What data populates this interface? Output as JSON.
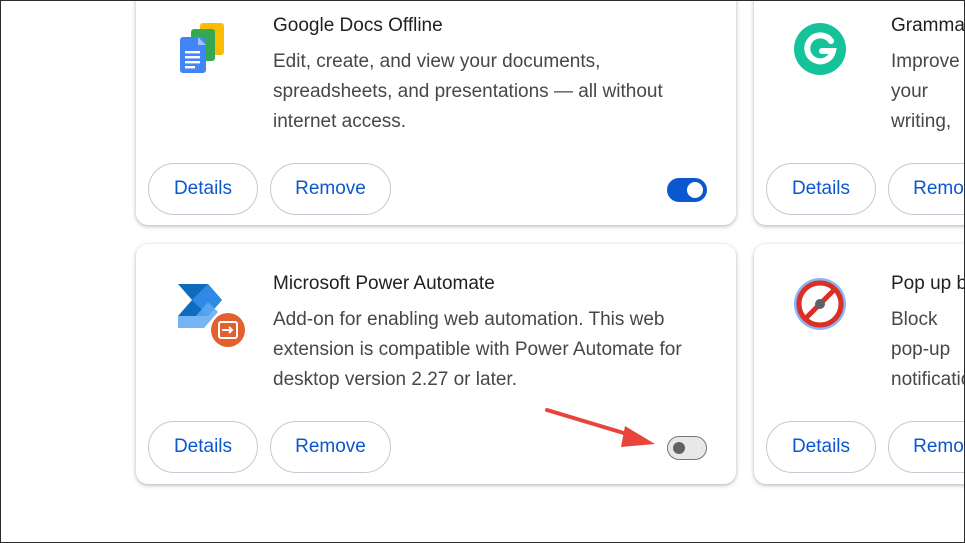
{
  "cards": [
    {
      "title": "Google Docs Offline",
      "description": "Edit, create, and view your documents, spreadsheets, and presentations — all without internet access.",
      "details_label": "Details",
      "remove_label": "Remove",
      "enabled": true,
      "icon": "google-docs-icon"
    },
    {
      "title": "Grammarly",
      "description": "Improve your writing, including grammar, and more.",
      "details_label": "Details",
      "remove_label": "Remove",
      "icon": "grammarly-icon"
    },
    {
      "title": "Microsoft Power Automate",
      "description": "Add-on for enabling web automation. This web extension is compatible with Power Automate for desktop version 2.27 or later.",
      "details_label": "Details",
      "remove_label": "Remove",
      "enabled": false,
      "icon": "power-automate-icon"
    },
    {
      "title": "Pop up blocker",
      "description": "Block pop-up notifications while browsing.",
      "details_label": "Details",
      "remove_label": "Remove",
      "icon": "popup-blocker-icon"
    }
  ],
  "colors": {
    "accent": "#0b57d0",
    "annotation_arrow": "#e8443a",
    "toggle_off_track": "#e8e8e8"
  }
}
